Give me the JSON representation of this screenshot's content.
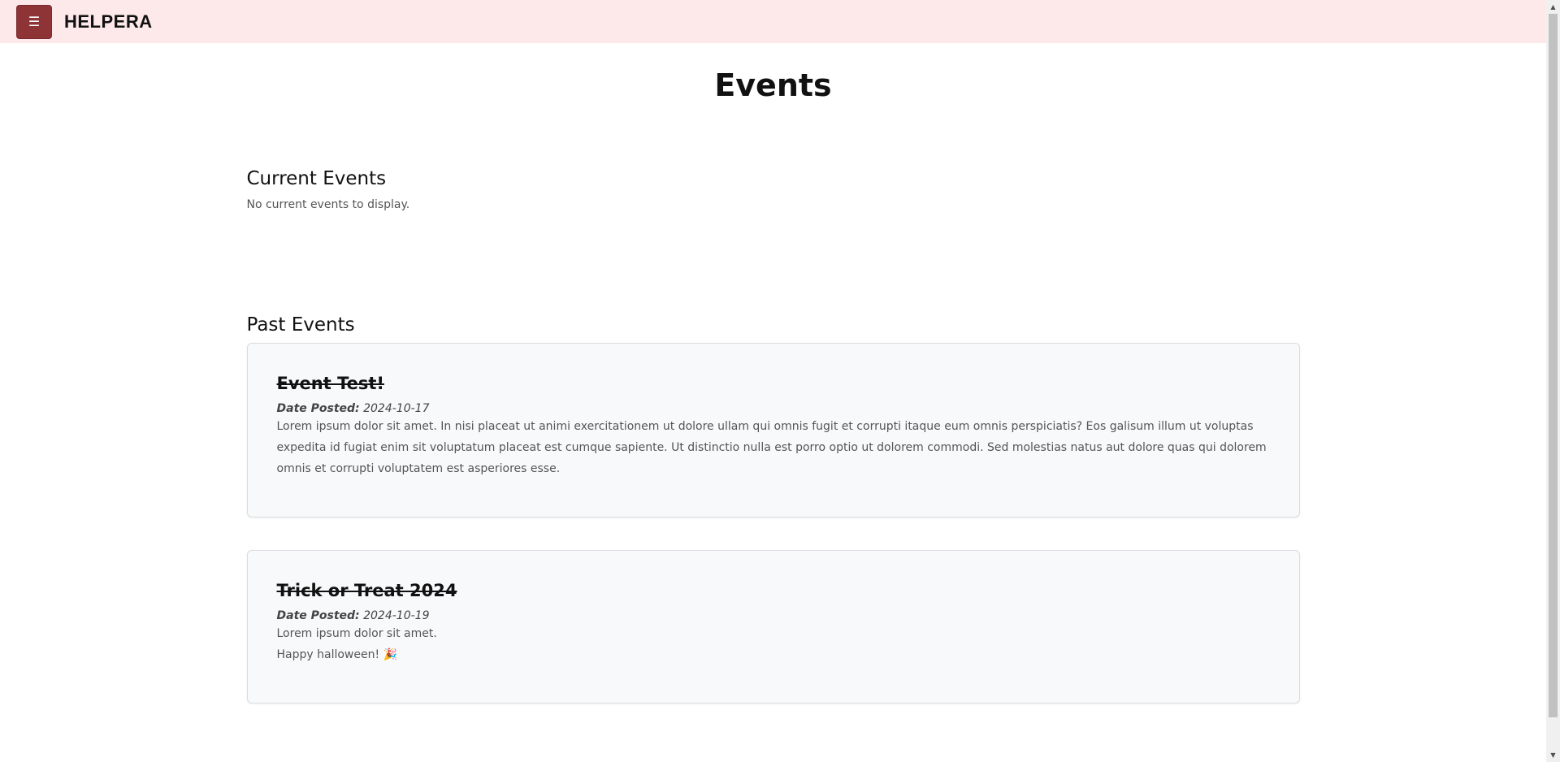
{
  "header": {
    "menu_icon": "☰",
    "brand": "HELPERA",
    "colors": {
      "background": "#fde9e9",
      "menu_button": "#8e3336"
    }
  },
  "main": {
    "title": "Events",
    "current": {
      "heading": "Current Events",
      "empty_text": "No current events to display."
    },
    "past": {
      "heading": "Past Events",
      "date_label": "Date Posted:",
      "events": [
        {
          "title": "Event Test!",
          "date": "2024-10-17",
          "body_lines": [
            "Lorem ipsum dolor sit amet. In nisi placeat ut animi exercitationem ut dolore ullam qui omnis fugit et corrupti itaque eum omnis perspiciatis? Eos galisum illum ut voluptas",
            "expedita id fugiat enim sit voluptatum placeat est cumque sapiente. Ut distinctio nulla est porro optio ut dolorem commodi. Sed molestias natus aut dolore quas qui dolorem",
            "omnis et corrupti voluptatem est asperiores esse."
          ]
        },
        {
          "title": "Trick or Treat 2024",
          "date": "2024-10-19",
          "body_lines": [
            "Lorem ipsum dolor sit amet.",
            "Happy halloween! 🎉"
          ]
        }
      ]
    }
  },
  "scrollbar": {
    "up_arrow": "▲",
    "down_arrow": "▼"
  }
}
